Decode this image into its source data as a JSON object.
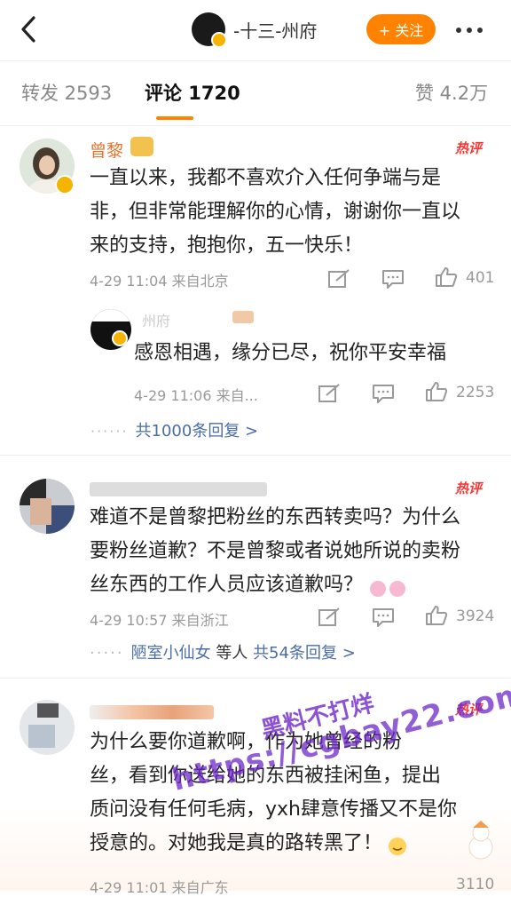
{
  "header": {
    "account_name": "-十三-州府",
    "follow_label": "+ 关注"
  },
  "tabs": [
    {
      "label": "转发 2593"
    },
    {
      "label": "评论 1720"
    },
    {
      "label": "赞 4.2万"
    }
  ],
  "comments": [
    {
      "name": "曾黎",
      "hot": "热评",
      "text_lines": [
        "一直以来，我都不喜欢介入任何争端与是",
        "非，但非常能理解你的心情，谢谢你一直以",
        "来的支持，抱抱你，五一快乐！"
      ],
      "meta": "4-29 11:04  来自北京",
      "likes": "401",
      "reply": {
        "name": "州府",
        "text": "感恩相遇，缘分已尽，祝你平安幸福",
        "meta": "4-29 11:06  来自...",
        "likes": "2253"
      },
      "more_link": "共1000条回复 >"
    },
    {
      "hot": "热评",
      "text_lines": [
        "难道不是曾黎把粉丝的东西转卖吗？为什么",
        "要粉丝道歉？不是曾黎或者说她所说的卖粉",
        "丝东西的工作人员应该道歉吗？"
      ],
      "meta": "4-29 10:57  来自浙江",
      "likes": "3924",
      "more_link_user": "陋室小仙女",
      "more_link_mid": " 等人 ",
      "more_link": "共54条回复 >"
    },
    {
      "hot": "热评",
      "text_lines": [
        "为什么要你道歉啊，作为她曾经的粉",
        "丝，看到你送给她的东西被挂闲鱼，提出",
        "质问没有任何毛病，yxh肆意传播又不是你",
        "授意的。对她我是真的路转黑了！"
      ],
      "meta": "4-29 11:01  来自广东",
      "likes": "3110"
    }
  ],
  "watermark": {
    "line1": "黑料不打烊",
    "line2": "https://cgbay22.com"
  }
}
